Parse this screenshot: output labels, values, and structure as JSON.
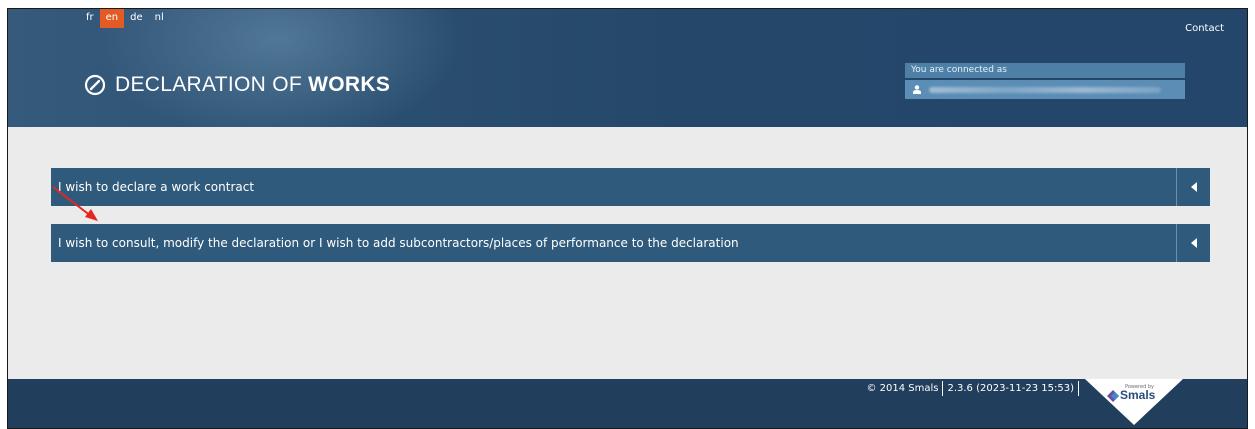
{
  "header": {
    "languages": [
      {
        "code": "fr",
        "active": false
      },
      {
        "code": "en",
        "active": true
      },
      {
        "code": "de",
        "active": false
      },
      {
        "code": "nl",
        "active": false
      }
    ],
    "contact_label": "Contact",
    "logo_icon": "compass-circle-icon",
    "logo_text_light": "DECLARATION OF ",
    "logo_text_bold": "WORKS",
    "user_box": {
      "title": "You are connected as",
      "user_icon": "user-icon",
      "username_redacted": true
    }
  },
  "main": {
    "accordions": [
      {
        "label": "I wish to declare a work contract",
        "toggle_icon": "caret-left-icon"
      },
      {
        "label": "I wish to consult, modify the declaration or I wish to add subcontractors/places of performance to the declaration",
        "toggle_icon": "caret-left-icon"
      }
    ],
    "annotation": "red-arrow-icon"
  },
  "footer": {
    "copyright": "© 2014 Smals",
    "version": "2.3.6 (2023-11-23 15:53)",
    "powered_by_small": "Powered by",
    "powered_by_brand": "Smals"
  },
  "colors": {
    "header_bg": "#2b4f70",
    "active_lang": "#e35b24",
    "accordion_bg": "#2f5a7b",
    "content_bg": "#ebebeb",
    "footer_bg": "#213f5c",
    "annotation_red": "#e52620"
  }
}
